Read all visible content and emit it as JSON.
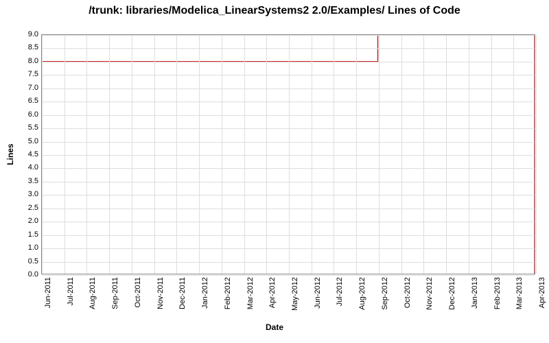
{
  "chart_data": {
    "type": "line",
    "title": "/trunk: libraries/Modelica_LinearSystems2 2.0/Examples/ Lines of Code",
    "xlabel": "Date",
    "ylabel": "Lines",
    "ylim": [
      0,
      9
    ],
    "x_categories": [
      "Jun-2011",
      "Jul-2011",
      "Aug-2011",
      "Sep-2011",
      "Oct-2011",
      "Nov-2011",
      "Dec-2011",
      "Jan-2012",
      "Feb-2012",
      "Mar-2012",
      "Apr-2012",
      "May-2012",
      "Jun-2012",
      "Jul-2012",
      "Aug-2012",
      "Sep-2012",
      "Oct-2012",
      "Nov-2012",
      "Dec-2012",
      "Jan-2013",
      "Feb-2013",
      "Mar-2013",
      "Apr-2013"
    ],
    "y_ticks": [
      0.0,
      0.5,
      1.0,
      1.5,
      2.0,
      2.5,
      3.0,
      3.5,
      4.0,
      4.5,
      5.0,
      5.5,
      6.0,
      6.5,
      7.0,
      7.5,
      8.0,
      8.5,
      9.0
    ],
    "series": [
      {
        "name": "Lines of Code",
        "color": "#cc0000",
        "points": [
          {
            "x": "Jun-2011",
            "y": 0
          },
          {
            "x": "Jun-2011",
            "y": 8
          },
          {
            "x": "Sep-2012",
            "y": 8
          },
          {
            "x": "Sep-2012",
            "y": 9
          },
          {
            "x": "Apr-2013",
            "y": 9
          },
          {
            "x": "Apr-2013",
            "y": 0
          }
        ]
      }
    ]
  }
}
